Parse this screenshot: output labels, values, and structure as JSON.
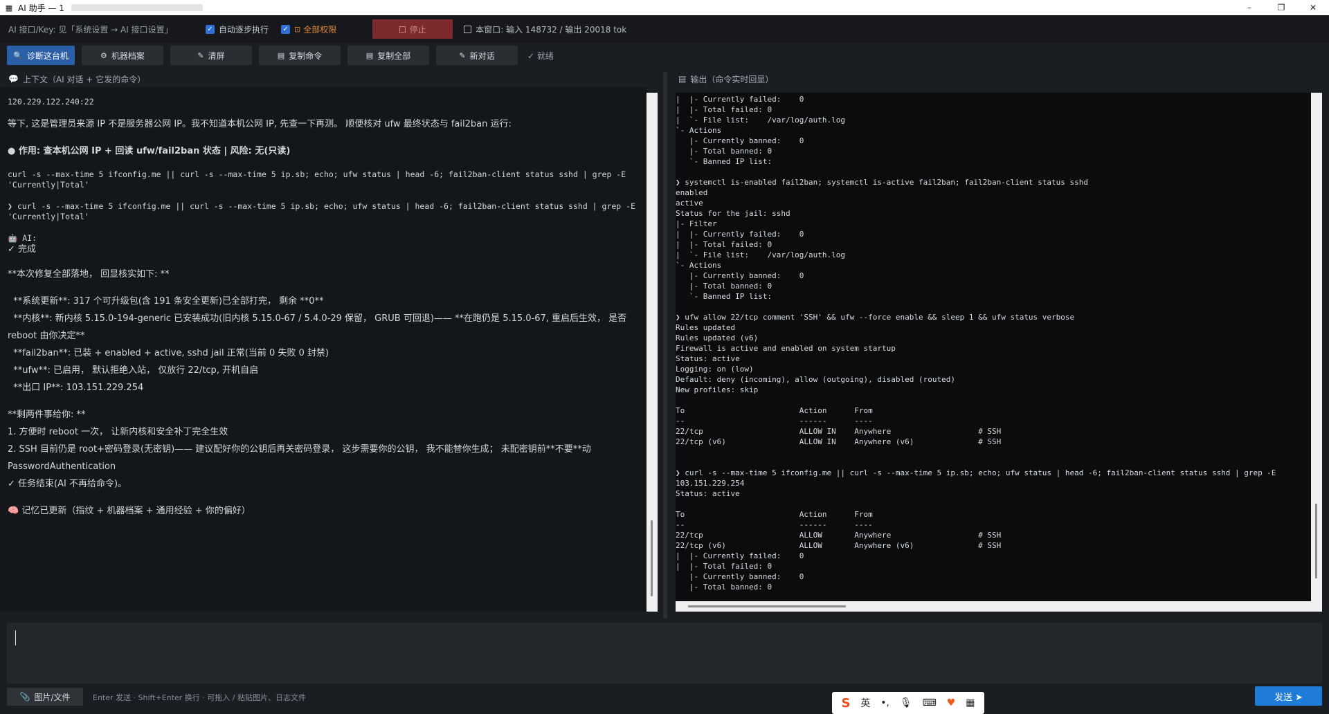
{
  "window": {
    "title": "AI 助手 — 1",
    "minimize": "–",
    "maximize": "❐",
    "close": "✕"
  },
  "topbar": {
    "hint": "AI 接口/Key: 见「系统设置 → AI 接口设置」",
    "auto_step_label": "自动逐步执行",
    "full_perm_label": "全部权限",
    "stop_label": "停止",
    "tokens": "本窗口: 输入 148732 / 输出 20018 tok"
  },
  "toolbar": {
    "diagnose": "诊断这台机",
    "machine_profile": "机器档案",
    "clear": "清屏",
    "copy_cmd": "复制命令",
    "copy_all": "复制全部",
    "new_chat": "新对话",
    "status": "✓ 就绪"
  },
  "context": {
    "header": "上下文（AI 对话 + 它发的命令）",
    "lines": {
      "addr": "120.229.122.240:22",
      "p1": "等下, 这是管理员来源 IP 不是服务器公网 IP。我不知道本机公网 IP, 先查一下再测。 顺便核对 ufw 最终状态与 fail2ban 运行:",
      "action": "● 作用: 查本机公网 IP + 回读 ufw/fail2ban 状态 | 风险: 无(只读)",
      "cmd1": "curl -s --max-time 5 ifconfig.me || curl -s --max-time 5 ip.sb; echo; ufw status | head -6; fail2ban-client status sshd | grep -E\n'Currently|Total'",
      "cmd2": "❯ curl -s --max-time 5 ifconfig.me || curl -s --max-time 5 ip.sb; echo; ufw status | head -6; fail2ban-client status sshd | grep -E\n'Currently|Total'",
      "ai_label": "AI:",
      "done": "✓ 完成",
      "summary_title": "**本次修复全部落地， 回显核实如下: **",
      "b1": "  **系统更新**: 317 个可升级包(含 191 条安全更新)已全部打完， 剩余 **0**",
      "b2": "  **内核**: 新内核 5.15.0-194-generic 已安装成功(旧内核 5.15.0-67 / 5.4.0-29 保留， GRUB 可回退)—— **在跑仍是 5.15.0-67, 重启后生效， 是否",
      "b2b": "reboot 由你决定**",
      "b3": "  **fail2ban**: 已装 + enabled + active, sshd jail 正常(当前 0 失败 0 封禁)",
      "b4": "  **ufw**: 已启用， 默认拒绝入站， 仅放行 22/tcp, 开机自启",
      "b5": "  **出口 IP**: 103.151.229.254",
      "left_title": "**剩两件事给你: **",
      "l1": "1. 方便时 reboot 一次， 让新内核和安全补丁完全生效",
      "l2": "2. SSH 目前仍是 root+密码登录(无密钥)—— 建议配好你的公钥后再关密码登录， 这步需要你的公钥， 我不能替你生成； 未配密钥前**不要**动",
      "l2b": "PasswordAuthentication",
      "task_end": "✓ 任务结束(AI 不再给命令)。",
      "memory": "记忆已更新（指纹 + 机器档案 + 通用经验 + 你的偏好）"
    }
  },
  "output": {
    "header": "输出（命令实时回显）",
    "text": "|  |- Currently failed:    0\n|  |- Total failed: 0\n|  `- File list:    /var/log/auth.log\n`- Actions\n   |- Currently banned:    0\n   |- Total banned: 0\n   `- Banned IP list:\n\n❯ systemctl is-enabled fail2ban; systemctl is-active fail2ban; fail2ban-client status sshd\nenabled\nactive\nStatus for the jail: sshd\n|- Filter\n|  |- Currently failed:    0\n|  |- Total failed: 0\n|  `- File list:    /var/log/auth.log\n`- Actions\n   |- Currently banned:    0\n   |- Total banned: 0\n   `- Banned IP list:\n\n❯ ufw allow 22/tcp comment 'SSH' && ufw --force enable && sleep 1 && ufw status verbose\nRules updated\nRules updated (v6)\nFirewall is active and enabled on system startup\nStatus: active\nLogging: on (low)\nDefault: deny (incoming), allow (outgoing), disabled (routed)\nNew profiles: skip\n\nTo                         Action      From\n--                         ------      ----\n22/tcp                     ALLOW IN    Anywhere                   # SSH\n22/tcp (v6)                ALLOW IN    Anywhere (v6)              # SSH\n\n\n❯ curl -s --max-time 5 ifconfig.me || curl -s --max-time 5 ip.sb; echo; ufw status | head -6; fail2ban-client status sshd | grep -E\n103.151.229.254\nStatus: active\n\nTo                         Action      From\n--                         ------      ----\n22/tcp                     ALLOW       Anywhere                   # SSH\n22/tcp (v6)                ALLOW       Anywhere (v6)              # SSH\n|  |- Currently failed:    0\n|  |- Total failed: 0\n   |- Currently banned:    0\n   |- Total banned: 0"
  },
  "input": {
    "value": "",
    "file_button": "图片/文件",
    "hint": "Enter 发送 · Shift+Enter 换行 · 可拖入 / 粘贴图片、日志文件",
    "send": "发送 ➤"
  },
  "ime": {
    "lang": "英",
    "punct": "•,",
    "mic": "🎙",
    "keyboard": "⌨",
    "apps": "▦"
  },
  "colors": {
    "accent": "#2b5fa8",
    "send": "#1f7bd8",
    "stop": "#7d2a2c",
    "command": "#e4c07a",
    "success": "#4fd06a"
  }
}
